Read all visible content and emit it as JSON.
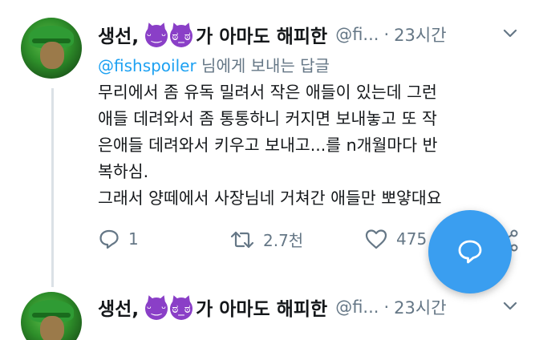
{
  "tweet1": {
    "author_prefix": "생선,",
    "emojis": [
      "smiling-devil-emoji",
      "angry-devil-emoji"
    ],
    "author_suffix": "가 아마도 해피한",
    "handle": "@fi...",
    "separator": "·",
    "time": "23시간",
    "reply_to_handle": "@fishspoiler",
    "reply_to_text": " 님에게 보내는 답글",
    "text_lines": [
      "무리에서 좀 유독 밀려서 작은 애들이 있는데 그런",
      "애들 데려와서 좀 통통하니 커지면 보내놓고 또 작",
      "은애들 데려와서 키우고 보내고...를 n개월마다 반",
      "복하심.",
      "그래서 양떼에서 사장님네 거쳐간 애들만 뽀얗대요"
    ],
    "reply_count": "1",
    "retweet_count": "2.7천",
    "like_count": "475"
  },
  "tweet2": {
    "author_prefix": "생선,",
    "author_suffix": "가 아마도 해피한",
    "handle": "@fi...",
    "separator": "·",
    "time": "23시간"
  },
  "colors": {
    "text": "#14171a",
    "secondary": "#657786",
    "link": "#1da1f2",
    "fab": "#3a9ef0",
    "thread_line": "#dbe1e6"
  }
}
